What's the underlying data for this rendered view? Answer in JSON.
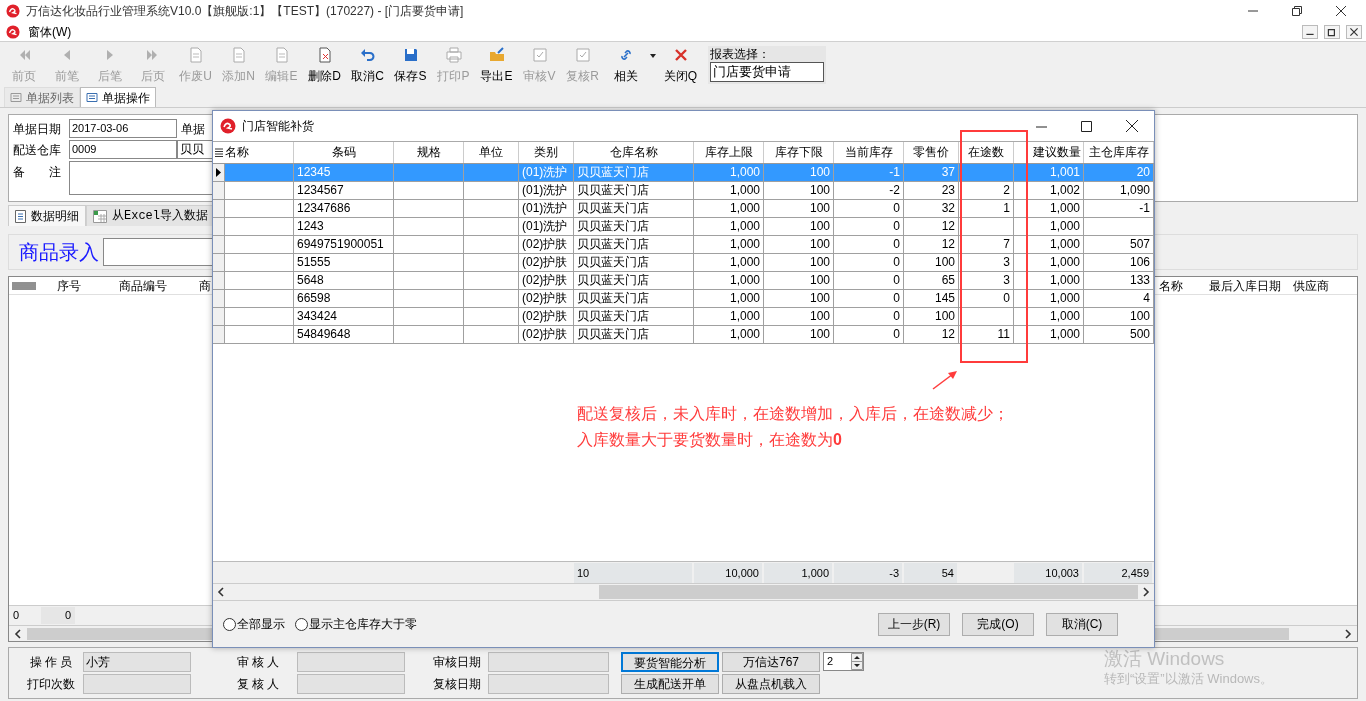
{
  "window": {
    "title": "万信达化妆品行业管理系统V10.0【旗舰版:1】【TEST】(170227) - [门店要货申请]"
  },
  "menu": [
    {
      "label": "窗体(W)"
    }
  ],
  "toolbar": [
    {
      "label": "前页",
      "disabled": true
    },
    {
      "label": "前笔",
      "disabled": true
    },
    {
      "label": "后笔",
      "disabled": true
    },
    {
      "label": "后页",
      "disabled": true
    },
    {
      "label": "作废U",
      "disabled": true
    },
    {
      "label": "添加N",
      "disabled": true
    },
    {
      "label": "编辑E",
      "disabled": true
    },
    {
      "label": "删除D",
      "disabled": false
    },
    {
      "label": "取消C",
      "disabled": false
    },
    {
      "label": "保存S",
      "disabled": false
    },
    {
      "label": "打印P",
      "disabled": true
    },
    {
      "label": "导出E",
      "disabled": false
    },
    {
      "label": "审核V",
      "disabled": true
    },
    {
      "label": "复核R",
      "disabled": true
    },
    {
      "label": "相关",
      "disabled": false
    },
    {
      "label": "关闭Q",
      "disabled": false
    }
  ],
  "report_select": {
    "label": "报表选择：",
    "value": "门店要货申请"
  },
  "tabs": [
    {
      "label": "单据列表",
      "selected": false
    },
    {
      "label": "单据操作",
      "selected": true
    }
  ],
  "form": {
    "date_label": "单据日期",
    "date_value": "2017-03-06",
    "number_label": "单据",
    "warehouse_label": "配送仓库",
    "warehouse_value": "0009",
    "warehouse_name": "贝贝",
    "remark_label": "备　　注"
  },
  "detail_tabs": [
    {
      "label": "数据明细",
      "selected": true
    },
    {
      "label": "从Excel导入数据",
      "selected": false
    }
  ],
  "product_entry": {
    "label": "商品录入"
  },
  "main_grid": {
    "columns_left": [
      "序号",
      "商品编号",
      "商"
    ],
    "columns_right": [
      "名称",
      "最后入库日期",
      "供应商"
    ],
    "footer": [
      "0",
      "0"
    ]
  },
  "dialog": {
    "title": "门店智能补货",
    "columns": [
      "名称",
      "条码",
      "规格",
      "单位",
      "类别",
      "仓库名称",
      "库存上限",
      "库存下限",
      "当前库存",
      "零售价",
      "在途数",
      "建议数量",
      "主仓库库存"
    ],
    "rows": [
      {
        "selected": true,
        "barcode": "12345",
        "category": "(01)洗护",
        "warehouse": "贝贝蓝天门店",
        "max": "1,000",
        "min": "100",
        "stock": "-1",
        "price": "37",
        "suggested": "1,001",
        "main_stock": "20"
      },
      {
        "selected": false,
        "barcode": "1234567",
        "category": "(01)洗护",
        "warehouse": "贝贝蓝天门店",
        "max": "1,000",
        "min": "100",
        "stock": "-2",
        "price": "23",
        "in_transit": "2",
        "suggested": "1,002",
        "main_stock": "1,090"
      },
      {
        "selected": false,
        "barcode": "12347686",
        "category": "(01)洗护",
        "warehouse": "贝贝蓝天门店",
        "max": "1,000",
        "min": "100",
        "stock": "0",
        "price": "32",
        "in_transit": "1",
        "suggested": "1,000",
        "main_stock": "-1"
      },
      {
        "selected": false,
        "barcode": "1243",
        "category": "(01)洗护",
        "warehouse": "贝贝蓝天门店",
        "max": "1,000",
        "min": "100",
        "stock": "0",
        "price": "12",
        "suggested": "1,000"
      },
      {
        "selected": false,
        "barcode": "6949751900051",
        "category": "(02)护肤",
        "warehouse": "贝贝蓝天门店",
        "max": "1,000",
        "min": "100",
        "stock": "0",
        "price": "12",
        "in_transit": "7",
        "suggested": "1,000",
        "main_stock": "507"
      },
      {
        "selected": false,
        "barcode": "51555",
        "category": "(02)护肤",
        "warehouse": "贝贝蓝天门店",
        "max": "1,000",
        "min": "100",
        "stock": "0",
        "price": "100",
        "in_transit": "3",
        "suggested": "1,000",
        "main_stock": "106"
      },
      {
        "selected": false,
        "barcode": "5648",
        "category": "(02)护肤",
        "warehouse": "贝贝蓝天门店",
        "max": "1,000",
        "min": "100",
        "stock": "0",
        "price": "65",
        "in_transit": "3",
        "suggested": "1,000",
        "main_stock": "133"
      },
      {
        "selected": false,
        "barcode": "66598",
        "category": "(02)护肤",
        "warehouse": "贝贝蓝天门店",
        "max": "1,000",
        "min": "100",
        "stock": "0",
        "price": "145",
        "in_transit": "0",
        "suggested": "1,000",
        "main_stock": "4"
      },
      {
        "selected": false,
        "barcode": "343424",
        "category": "(02)护肤",
        "warehouse": "贝贝蓝天门店",
        "max": "1,000",
        "min": "100",
        "stock": "0",
        "price": "100",
        "suggested": "1,000",
        "main_stock": "100"
      },
      {
        "selected": false,
        "barcode": "54849648",
        "category": "(02)护肤",
        "warehouse": "贝贝蓝天门店",
        "max": "1,000",
        "min": "100",
        "stock": "0",
        "price": "12",
        "in_transit": "11",
        "suggested": "1,000",
        "main_stock": "500"
      }
    ],
    "totals": {
      "warehouse": "10",
      "max": "10,000",
      "min": "1,000",
      "stock": "-3",
      "price": "54",
      "suggested": "10,003",
      "main_stock": "2,459"
    },
    "annotation": {
      "lines": [
        "配送复核后，未入库时，在途数增加，入库后，在途数减少；",
        "入库数量大于要货数量时，在途数为**0**"
      ]
    },
    "radios": [
      {
        "label": "全部显示",
        "selected": false
      },
      {
        "label": "显示主仓库存大于零",
        "selected": false
      }
    ],
    "buttons": [
      "上一步(R)",
      "完成(O)",
      "取消(C)"
    ]
  },
  "bottom_panel": {
    "fields": [
      {
        "label": "操 作 员",
        "value": "小芳"
      },
      {
        "label": "打印次数"
      },
      {
        "label": "审 核 人"
      },
      {
        "label": "复 核 人"
      },
      {
        "label": "审核日期"
      },
      {
        "label": "复核日期"
      }
    ],
    "buttons": [
      {
        "label": "要货智能分析",
        "selected": true
      },
      {
        "label": "万信达767",
        "selected": false
      },
      {
        "label": "生成配送开单",
        "selected": false
      },
      {
        "label": "从盘点机载入",
        "selected": false
      }
    ],
    "spinner": "2"
  },
  "os_notice": {
    "title": "激活 Windows",
    "text": "转到“设置”以激活 Windows。"
  }
}
